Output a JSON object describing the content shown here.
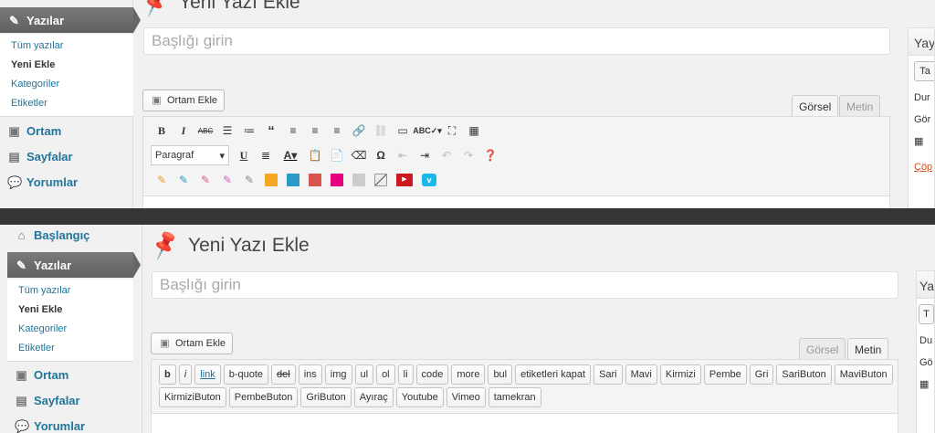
{
  "top": {
    "page_title": "Yeni Yazı Ekle",
    "menu_active": "Yazılar",
    "submenu": [
      "Tüm yazılar",
      "Yeni Ekle",
      "Kategoriler",
      "Etiketler"
    ],
    "menu_after": [
      "Ortam",
      "Sayfalar",
      "Yorumlar"
    ],
    "title_placeholder": "Başlığı girin",
    "media_button": "Ortam Ekle",
    "tab_visual": "Görsel",
    "tab_text": "Metin",
    "format_select": "Paragraf",
    "color_swatches": [
      "#f5a623",
      "#2a9bc6",
      "#d9534f",
      "#e6007e",
      "#cccccc"
    ],
    "publish_box": {
      "title": "Yay",
      "btn": "Ta",
      "line1": "Dur",
      "line2": "Gör",
      "line3": "",
      "trash": "Çöp"
    }
  },
  "bottom": {
    "page_title": "Yeni Yazı Ekle",
    "menu_dashboard": "Başlangıç",
    "menu_active": "Yazılar",
    "submenu": [
      "Tüm yazılar",
      "Yeni Ekle",
      "Kategoriler",
      "Etiketler"
    ],
    "menu_after": [
      "Ortam",
      "Sayfalar",
      "Yorumlar"
    ],
    "title_placeholder": "Başlığı girin",
    "media_button": "Ortam Ekle",
    "tab_visual": "Görsel",
    "tab_text": "Metin",
    "quicktags_row1": [
      "b",
      "i",
      "link",
      "b-quote",
      "del",
      "ins",
      "img",
      "ul",
      "ol",
      "li",
      "code",
      "more",
      "bul",
      "etiketleri kapat",
      "Sari",
      "Mavi",
      "Kirmizi",
      "Pembe",
      "Gri",
      "SariButon",
      "MaviButon"
    ],
    "quicktags_row2": [
      "KirmiziButon",
      "PembeButon",
      "GriButon",
      "Ayıraç",
      "Youtube",
      "Vimeo",
      "tamekran"
    ],
    "publish_box": {
      "title": "Yay",
      "btn": "T",
      "line1": "Du",
      "line2": "Gö"
    }
  }
}
